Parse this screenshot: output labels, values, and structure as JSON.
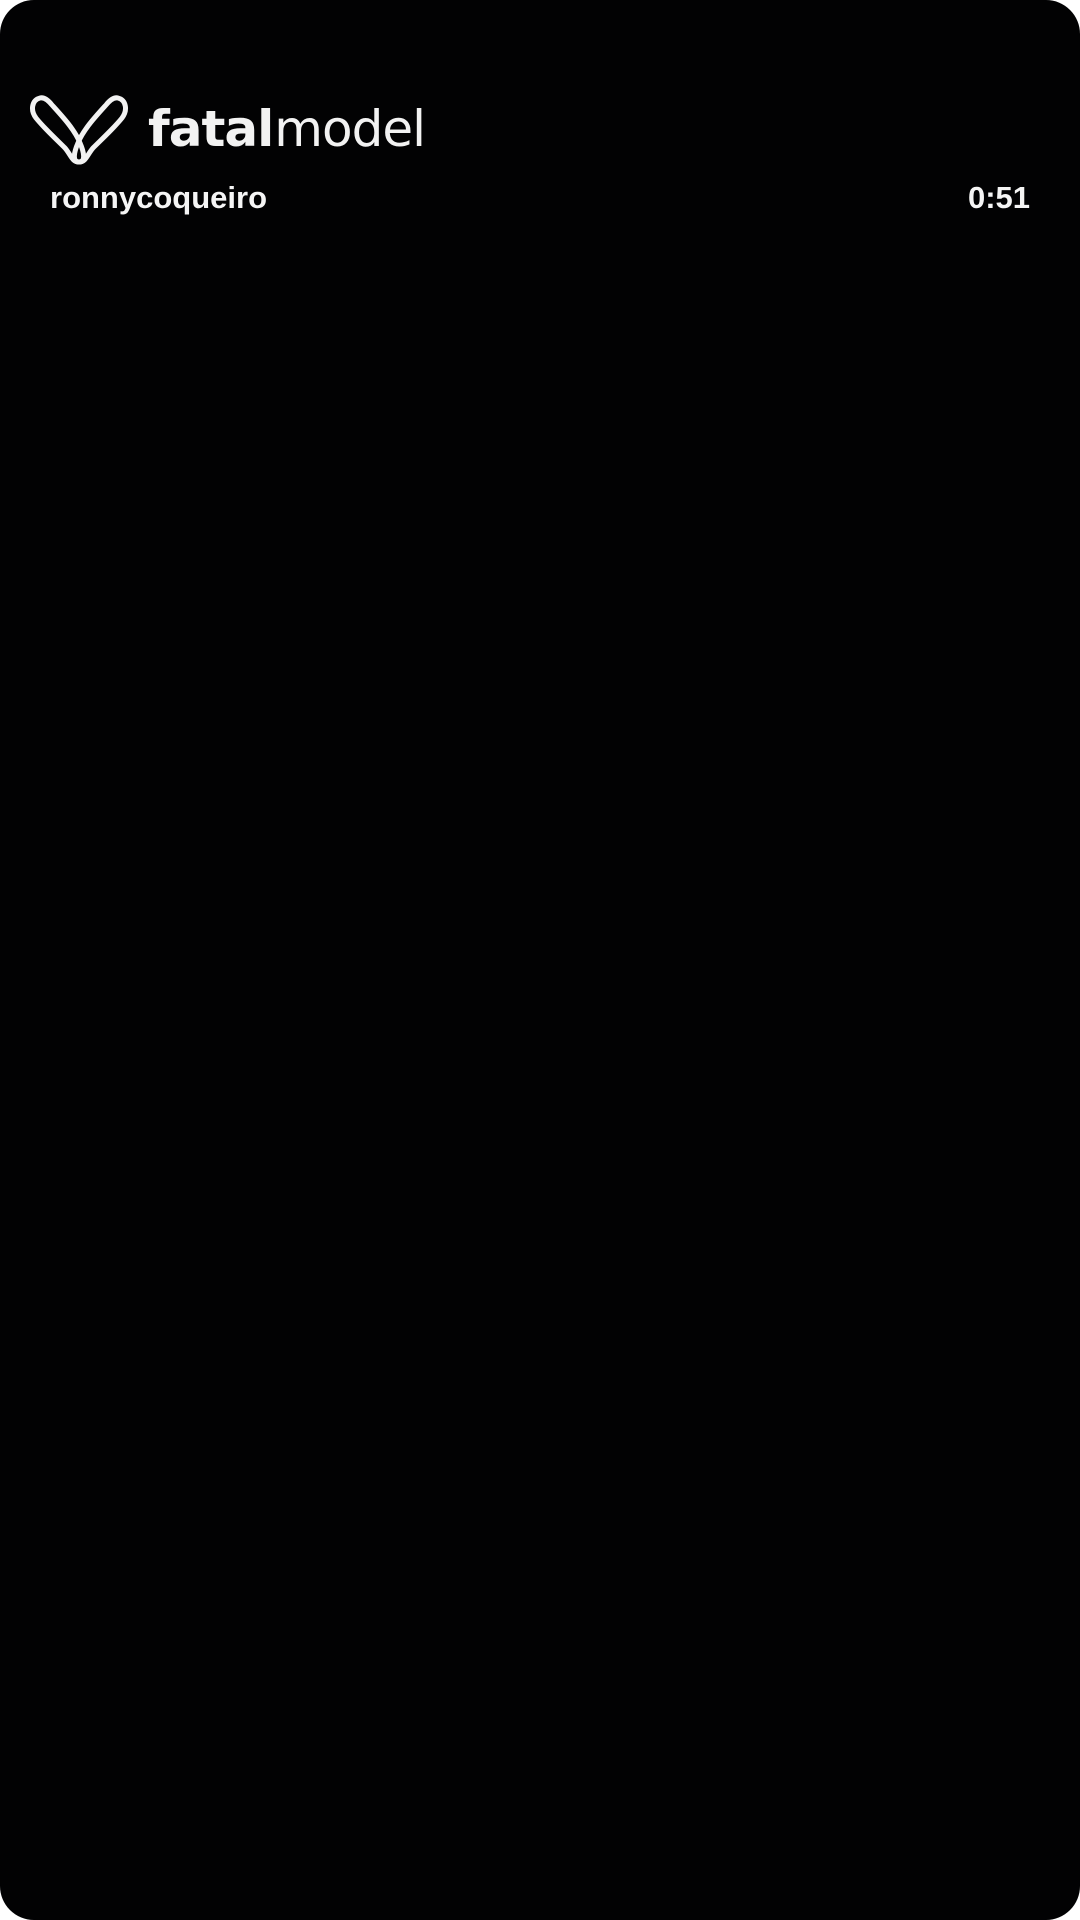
{
  "brand": {
    "logo_icon": "butterfly-logo-icon",
    "name_bold": "fatal",
    "name_light": "model"
  },
  "story": {
    "username": "ronnycoqueiro",
    "duration": "0:51"
  },
  "colors": {
    "background": "#020203",
    "text": "#f5f5f5"
  }
}
